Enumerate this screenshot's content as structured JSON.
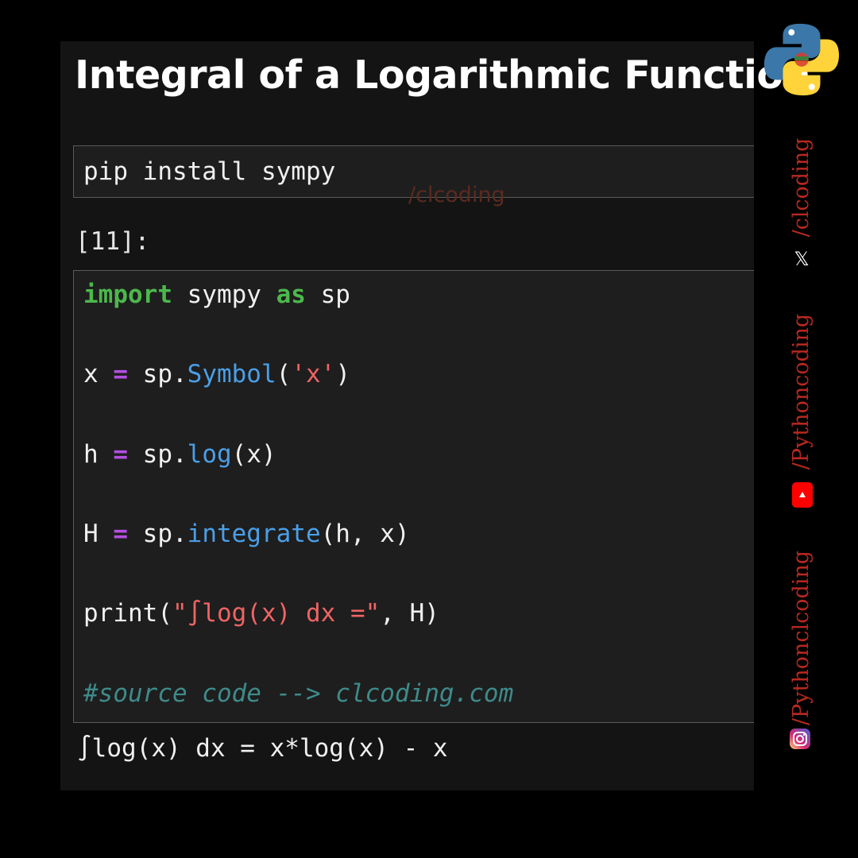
{
  "title": "Integral of a Logarithmic Function",
  "watermark": "/clcoding",
  "install_cell": {
    "text": "pip install sympy"
  },
  "prompt": "[11]:",
  "code": {
    "line1": {
      "kw1": "import",
      "mid": " sympy ",
      "kw2": "as",
      "end": " sp"
    },
    "line2": {
      "var": "x ",
      "op": "=",
      "obj": " sp.",
      "fn": "Symbol",
      "open": "(",
      "arg": "'x'",
      "close": ")"
    },
    "line3": {
      "var": "h ",
      "op": "=",
      "obj": " sp.",
      "fn": "log",
      "args": "(x)"
    },
    "line4": {
      "var": "H ",
      "op": "=",
      "obj": " sp.",
      "fn": "integrate",
      "args": "(h, x)"
    },
    "line5": {
      "call": "print(",
      "str": "\"∫log(x) dx =\"",
      "rest": ", H)"
    },
    "line6": {
      "comment": "#source code --> clcoding.com"
    }
  },
  "output": "∫log(x) dx = x*log(x) - x",
  "social": {
    "x_handle": "/clcoding",
    "youtube_handle": "/Pythoncoding",
    "instagram_handle": "/Pythonclcoding",
    "x_glyph": "𝕏"
  },
  "colors": {
    "background": "#000000",
    "panel": "#141414",
    "cell": "#1e1e1e",
    "keyword": "#4cb84c",
    "operator": "#b34fe0",
    "function": "#4a9fe8",
    "string": "#f06464",
    "comment": "#3f8a8a",
    "social_text": "#b8291f",
    "youtube": "#ff0000"
  }
}
